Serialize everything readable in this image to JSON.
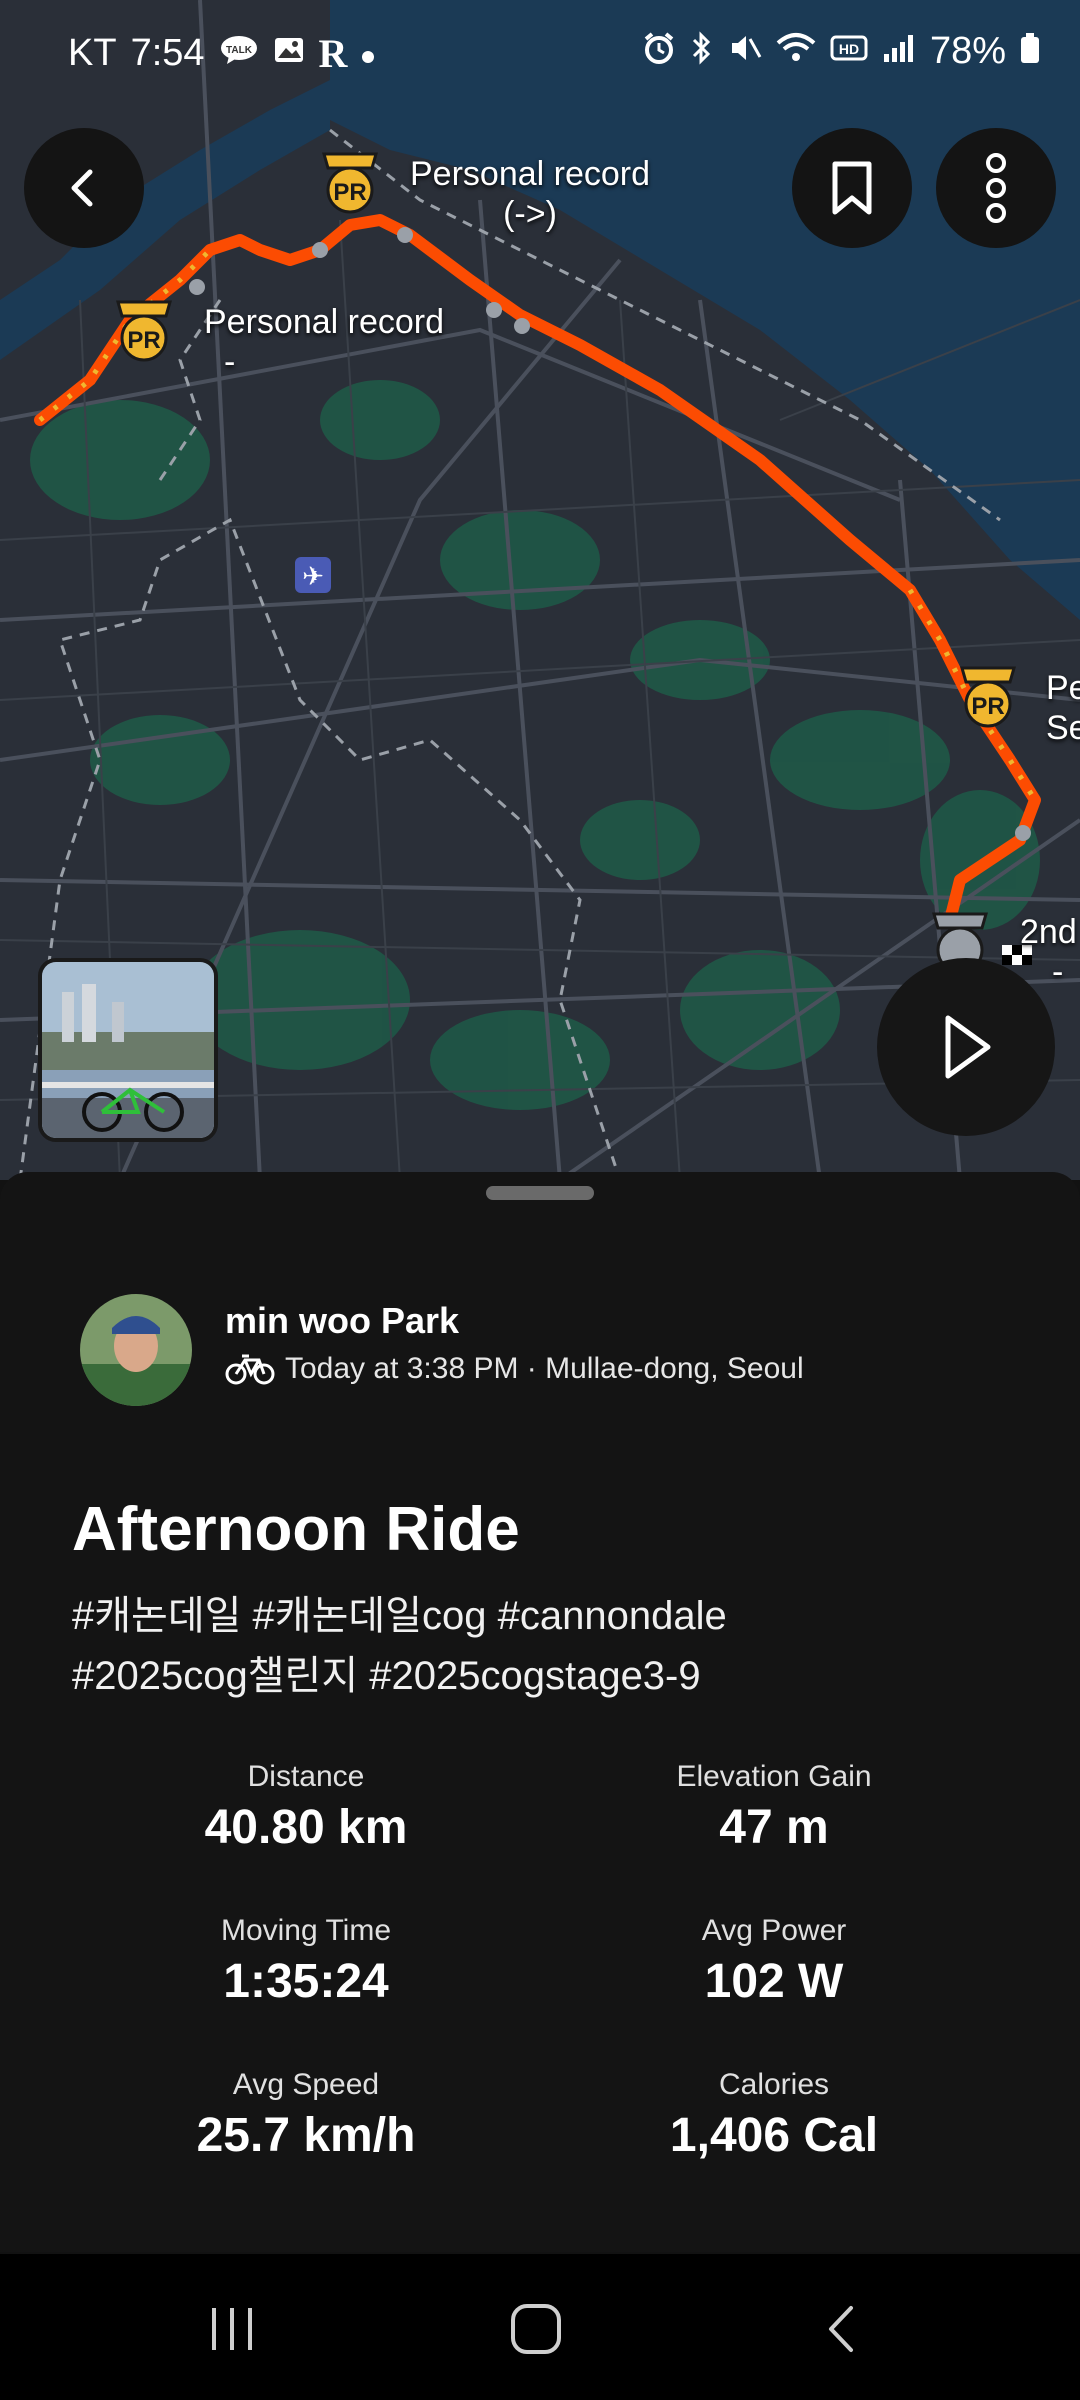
{
  "status_bar": {
    "carrier": "KT",
    "time": "7:54",
    "battery": "78%",
    "left_icons": [
      "talk-icon",
      "image-icon",
      "r-app-icon",
      "dot-icon"
    ],
    "right_icons": [
      "alarm-icon",
      "bluetooth-icon",
      "mute-icon",
      "wifi-icon",
      "hd-icon",
      "signal-icon",
      "battery-icon"
    ]
  },
  "map": {
    "pr_labels": [
      {
        "line1": "Personal record",
        "line2": "(->)"
      },
      {
        "line1": "Personal record",
        "line2": "-"
      },
      {
        "line1": "Pe",
        "line2": "Se"
      },
      {
        "line1": "2nd",
        "line2": "-"
      }
    ],
    "pr_badge_text": "PR",
    "colors": {
      "route": "#fc4c02",
      "badge": "#f0b72f",
      "water": "#1b3a55",
      "park": "#1e5a48"
    }
  },
  "activity": {
    "athlete_name": "min woo Park",
    "meta": "Today at 3:38 PM · Mullae-dong, Seoul",
    "title": "Afternoon Ride",
    "tags_line1": "#캐논데일 #캐논데일cog #cannondale",
    "tags_line2": "#2025cog챌린지 #2025cogstage3-9",
    "stats": [
      {
        "label": "Distance",
        "value": "40.80 km"
      },
      {
        "label": "Elevation Gain",
        "value": "47 m"
      },
      {
        "label": "Moving Time",
        "value": "1:35:24"
      },
      {
        "label": "Avg Power",
        "value": "102 W"
      },
      {
        "label": "Avg Speed",
        "value": "25.7 km/h"
      },
      {
        "label": "Calories",
        "value": "1,406 Cal"
      }
    ]
  }
}
